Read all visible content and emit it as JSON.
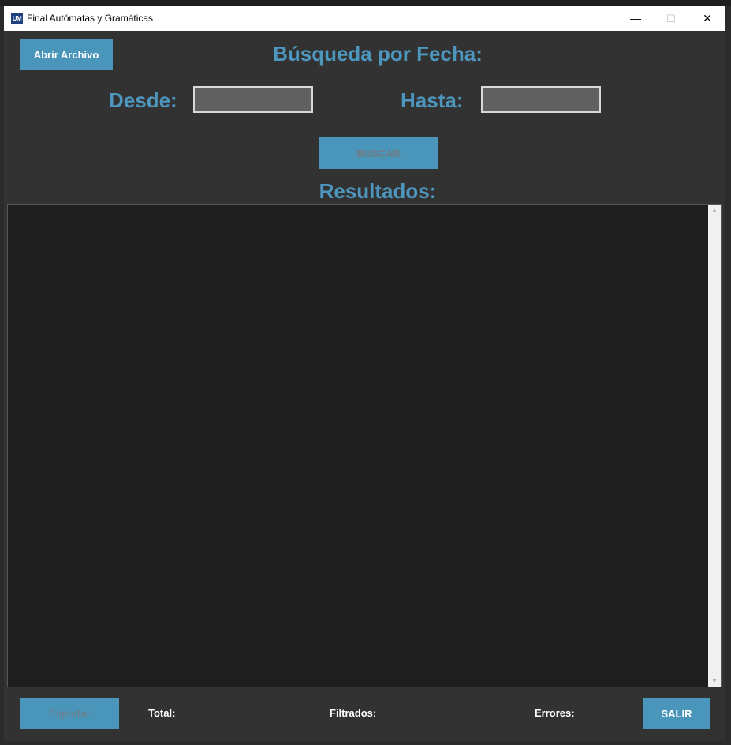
{
  "window": {
    "title": "Final Autómatas y Gramáticas",
    "icon_text": "UM",
    "controls": {
      "minimize": "—",
      "maximize": "☐",
      "close": "✕"
    }
  },
  "toolbar": {
    "open_file_label": "Abrir Archivo"
  },
  "search": {
    "heading": "Búsqueda por Fecha:",
    "from_label": "Desde:",
    "from_value": "",
    "to_label": "Hasta:",
    "to_value": "",
    "search_button": "BUSCAR"
  },
  "results": {
    "heading": "Resultados:",
    "content": ""
  },
  "footer": {
    "export_label": "Exportar",
    "total_label": "Total:",
    "filtered_label": "Filtrados:",
    "errors_label": "Errores:",
    "exit_label": "SALIR"
  },
  "colors": {
    "accent": "#4a96bb",
    "heading": "#4d96bd",
    "background": "#323232",
    "results_background": "#1e1e1e"
  }
}
